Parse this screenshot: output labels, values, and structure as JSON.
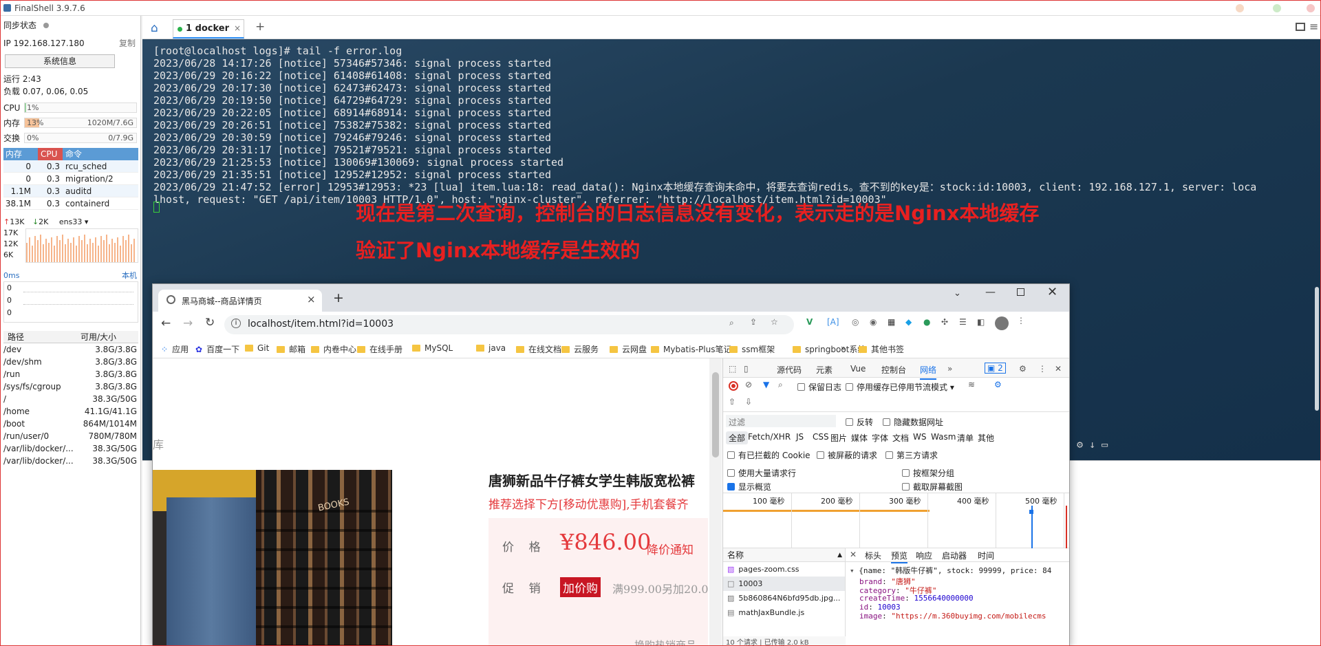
{
  "app": {
    "title": "FinalShell 3.9.7.6"
  },
  "left": {
    "sync_label": "同步状态",
    "ip": "IP 192.168.127.180",
    "copy": "复制",
    "sysinfo_button": "系统信息",
    "uptime": "运行 2:43",
    "load": "负载 0.07, 0.06, 0.05",
    "cpu_label": "CPU",
    "cpu_pct": "1%",
    "mem_label": "内存",
    "mem_pct": "13%",
    "mem_used": "1020M/7.6G",
    "swap_label": "交换",
    "swap_pct": "0%",
    "swap_used": "0/7.9G",
    "proc_headers": [
      "内存",
      "CPU",
      "命令"
    ],
    "procs": [
      {
        "mem": "0",
        "cpu": "0.3",
        "cmd": "rcu_sched"
      },
      {
        "mem": "0",
        "cpu": "0.3",
        "cmd": "migration/2"
      },
      {
        "mem": "1.1M",
        "cpu": "0.3",
        "cmd": "auditd"
      },
      {
        "mem": "38.1M",
        "cpu": "0.3",
        "cmd": "containerd"
      }
    ],
    "net_up": "13K",
    "net_down": "2K",
    "net_iface": "ens33",
    "net_ticks": [
      "17K",
      "12K",
      "6K"
    ],
    "lat_label": "0ms",
    "lat_host": "本机",
    "lat_ticks": [
      "0",
      "0",
      "0"
    ],
    "disk_headers": [
      "路径",
      "可用/大小"
    ],
    "disks": [
      {
        "path": "/dev",
        "size": "3.8G/3.8G"
      },
      {
        "path": "/dev/shm",
        "size": "3.8G/3.8G"
      },
      {
        "path": "/run",
        "size": "3.8G/3.8G"
      },
      {
        "path": "/sys/fs/cgroup",
        "size": "3.8G/3.8G"
      },
      {
        "path": "/",
        "size": "38.3G/50G"
      },
      {
        "path": "/home",
        "size": "41.1G/41.1G"
      },
      {
        "path": "/boot",
        "size": "864M/1014M"
      },
      {
        "path": "/run/user/0",
        "size": "780M/780M"
      },
      {
        "path": "/var/lib/docker/...",
        "size": "38.3G/50G"
      },
      {
        "path": "/var/lib/docker/...",
        "size": "38.3G/50G"
      }
    ]
  },
  "tabs": {
    "session": "1 docker",
    "add": "+"
  },
  "terminal": {
    "lines": [
      "[root@localhost logs]# tail -f error.log",
      "2023/06/28 14:17:26 [notice] 57346#57346: signal process started",
      "2023/06/29 20:16:22 [notice] 61408#61408: signal process started",
      "2023/06/29 20:17:30 [notice] 62473#62473: signal process started",
      "2023/06/29 20:19:50 [notice] 64729#64729: signal process started",
      "2023/06/29 20:22:05 [notice] 68914#68914: signal process started",
      "2023/06/29 20:26:51 [notice] 75382#75382: signal process started",
      "2023/06/29 20:30:59 [notice] 79246#79246: signal process started",
      "2023/06/29 20:31:17 [notice] 79521#79521: signal process started",
      "2023/06/29 21:25:53 [notice] 130069#130069: signal process started",
      "2023/06/29 21:35:51 [notice] 12952#12952: signal process started",
      "2023/06/29 21:47:52 [error] 12953#12953: *23 [lua] item.lua:18: read_data(): Nginx本地缓存查询未命中，将要去查询redis。查不到的key是：stock:id:10003, client: 192.168.127.1, server: loca",
      "lhost, request: \"GET /api/item/10003 HTTP/1.0\", host: \"nginx-cluster\", referrer: \"http://localhost/item.html?id=10003\""
    ],
    "annotation1": "现在是第二次查询，控制台的日志信息没有变化，表示走的是Nginx本地缓存",
    "annotation2": "验证了Nginx本地缓存是生效的"
  },
  "chrome": {
    "tab_title": "黑马商城--商品详情页",
    "url": "localhost/item.html?id=10003",
    "bookmarks": [
      "应用",
      "百度一下",
      "Git",
      "邮箱",
      "内卷中心",
      "在线手册",
      "MySQL",
      "java",
      "在线文档",
      "云服务",
      "云网盘",
      "Mybatis-Plus笔记",
      "ssm框架",
      "springboot系统",
      "其他书签"
    ]
  },
  "product": {
    "side_char": "库",
    "title": "唐狮新品牛仔裤女学生韩版宽松裤",
    "promo": "推荐选择下方[移动优惠购],手机套餐齐",
    "price_label": "价    格",
    "price": "¥846.00",
    "price_notice": "降价通知",
    "promo_label": "促    销",
    "promo_badge": "加价购",
    "promo_text": "满999.00另加20.0",
    "promo_more": "换购热销商品",
    "photo_text": "BOOKS"
  },
  "devtools": {
    "tabs": [
      "源代码",
      "元素",
      "Vue",
      "控制台",
      "网络"
    ],
    "badge": "2",
    "preserve_log": "保留日志",
    "disable_cache": "停用缓存",
    "throttle": "已停用节流模式",
    "filter_placeholder": "过滤",
    "invert": "反转",
    "hide_data": "隐藏数据网址",
    "types": [
      "全部",
      "Fetch/XHR",
      "JS",
      "CSS",
      "图片",
      "媒体",
      "字体",
      "文档",
      "WS",
      "Wasm",
      "清单",
      "其他"
    ],
    "blocked_cookies": "有已拦截的 Cookie",
    "blocked_requests": "被屏蔽的请求",
    "third_party": "第三方请求",
    "big_rows": "使用大量请求行",
    "group_frame": "按框架分组",
    "overview": "显示概览",
    "screenshots": "截取屏幕截图",
    "timeline": [
      "100 毫秒",
      "200 毫秒",
      "300 毫秒",
      "400 毫秒",
      "500 毫秒"
    ],
    "name_header": "名称",
    "requests": [
      "pages-zoom.css",
      "10003",
      "5b860864N6bfd95db.jpg...",
      "mathJaxBundle.js"
    ],
    "detail_tabs": [
      "标头",
      "预览",
      "响应",
      "启动器",
      "时间"
    ],
    "json_summary": "{name: \"韩版牛仔裤\", stock: 99999, price: 84",
    "json_fields": [
      {
        "k": "brand",
        "v": "\"唐狮\""
      },
      {
        "k": "category",
        "v": "\"牛仔裤\""
      },
      {
        "k": "createTime",
        "v": "1556640000000"
      },
      {
        "k": "id",
        "v": "10003"
      },
      {
        "k": "image",
        "v": "\"https://m.360buyimg.com/mobilecms"
      }
    ],
    "status_requests": "10 个请求",
    "status_transfer": "已传输 2.0 kB"
  },
  "colors": {
    "accent": "#e82020",
    "term_bg": "#1b3850",
    "cpu_header": "#d9534f",
    "proc_header": "#5b9bd5"
  }
}
